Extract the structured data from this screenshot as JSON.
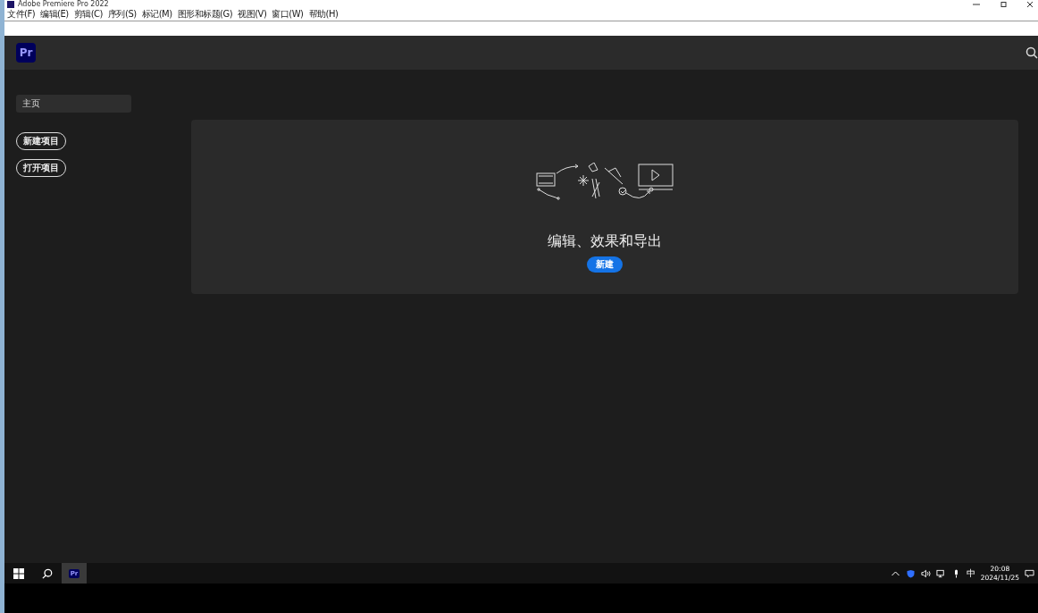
{
  "window": {
    "title": "Adobe Premiere Pro 2022"
  },
  "menu": [
    "文件(F)",
    "编辑(E)",
    "剪辑(C)",
    "序列(S)",
    "标记(M)",
    "图形和标题(G)",
    "视图(V)",
    "窗口(W)",
    "帮助(H)"
  ],
  "app_header": {
    "logo": "Pr"
  },
  "sidebar": {
    "items": [
      {
        "label": "主页",
        "selected": true
      }
    ],
    "buttons": [
      "新建项目",
      "打开项目"
    ]
  },
  "panel": {
    "heading": "编辑、效果和导出",
    "button": "新建"
  },
  "taskbar": {
    "app_logo": "Pr",
    "ime": "中",
    "time": "20:08",
    "date": "2024/11/25"
  }
}
